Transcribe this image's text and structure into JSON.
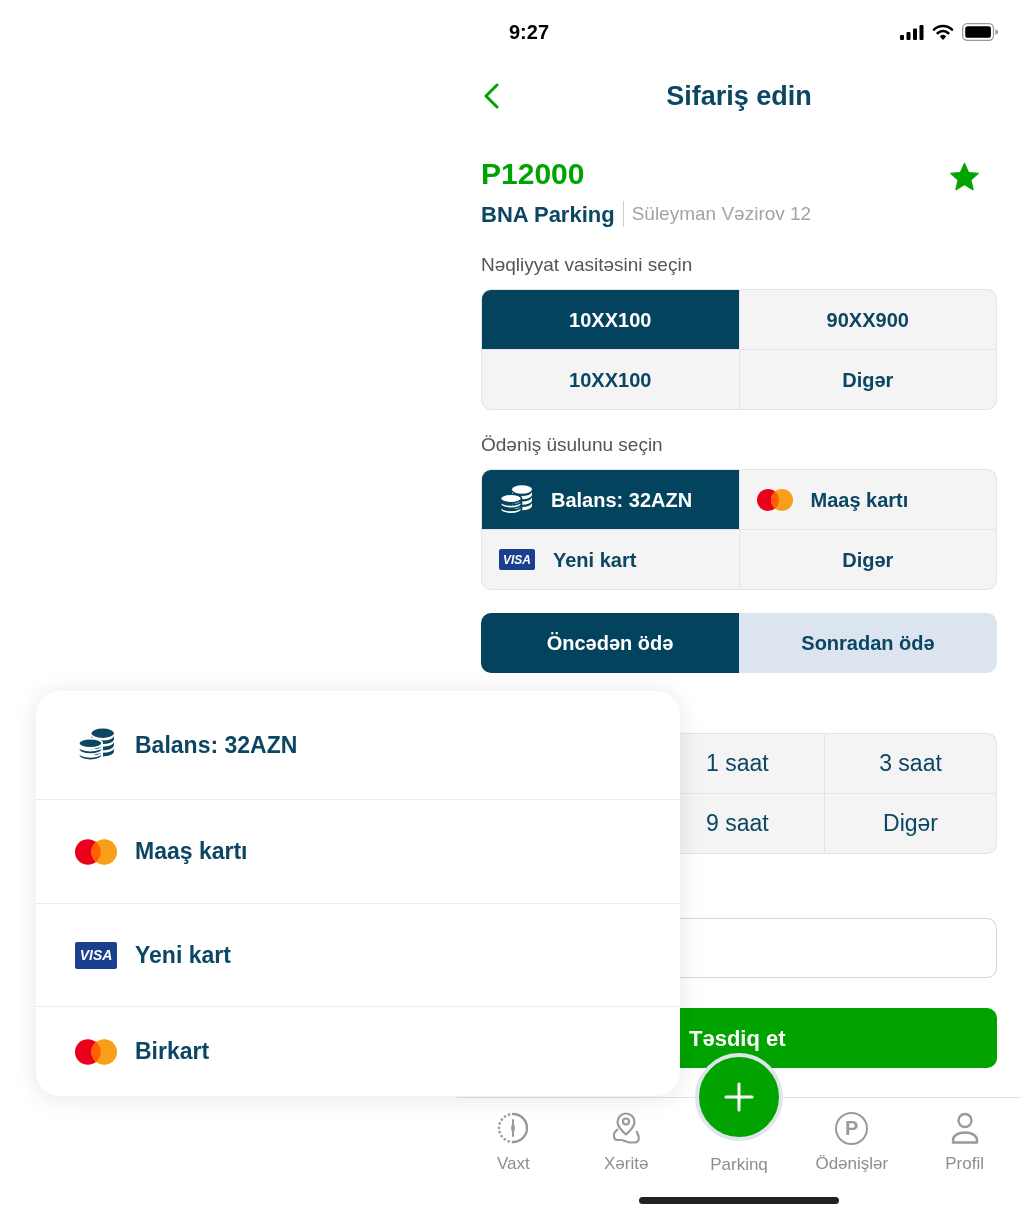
{
  "status_bar": {
    "time": "9:27"
  },
  "header": {
    "title": "Sifariş edin"
  },
  "parking": {
    "code": "P12000",
    "favorite": true,
    "name": "BNA Parking",
    "address": "Süleyman Vəzirov 12"
  },
  "vehicle_section": {
    "label": "Nəqliyyat vasitəsini seçin",
    "options": [
      {
        "label": "10XX100",
        "selected": true
      },
      {
        "label": "90XX900",
        "selected": false
      },
      {
        "label": "10XX100",
        "selected": false
      },
      {
        "label": "Digər",
        "selected": false
      }
    ]
  },
  "payment_section": {
    "label": "Ödəniş üsulunu seçin",
    "options": [
      {
        "kind": "balance",
        "label": "Balans: 32AZN",
        "selected": true
      },
      {
        "kind": "mastercard",
        "label": "Maaş kartı",
        "selected": false
      },
      {
        "kind": "visa",
        "badge": "VISA",
        "label": "Yeni kart",
        "selected": false
      },
      {
        "kind": "other",
        "label": "Digər",
        "selected": false
      }
    ]
  },
  "payment_timing": {
    "options": [
      {
        "label": "Öncədən ödə",
        "selected": true
      },
      {
        "label": "Sonradan ödə",
        "selected": false
      }
    ]
  },
  "duration_options": [
    {
      "label": "1 saat"
    },
    {
      "label": "3 saat"
    },
    {
      "label": "9 saat"
    },
    {
      "label": "Digər"
    }
  ],
  "confirm_button": {
    "label": "Təsdiq et"
  },
  "payment_popup": {
    "items": [
      {
        "kind": "balance",
        "label": "Balans: 32AZN"
      },
      {
        "kind": "mastercard",
        "label": "Maaş kartı"
      },
      {
        "kind": "visa",
        "badge": "VISA",
        "label": "Yeni kart"
      },
      {
        "kind": "mastercard",
        "label": "Birkart"
      }
    ]
  },
  "bottom_nav": {
    "items": [
      {
        "kind": "timer",
        "label": "Vaxt"
      },
      {
        "kind": "map",
        "label": "Xəritə"
      },
      {
        "kind": "add",
        "label": "Parkinq"
      },
      {
        "kind": "parking",
        "glyph": "P",
        "label": "Ödənişlər"
      },
      {
        "kind": "profile",
        "label": "Profil"
      }
    ]
  }
}
